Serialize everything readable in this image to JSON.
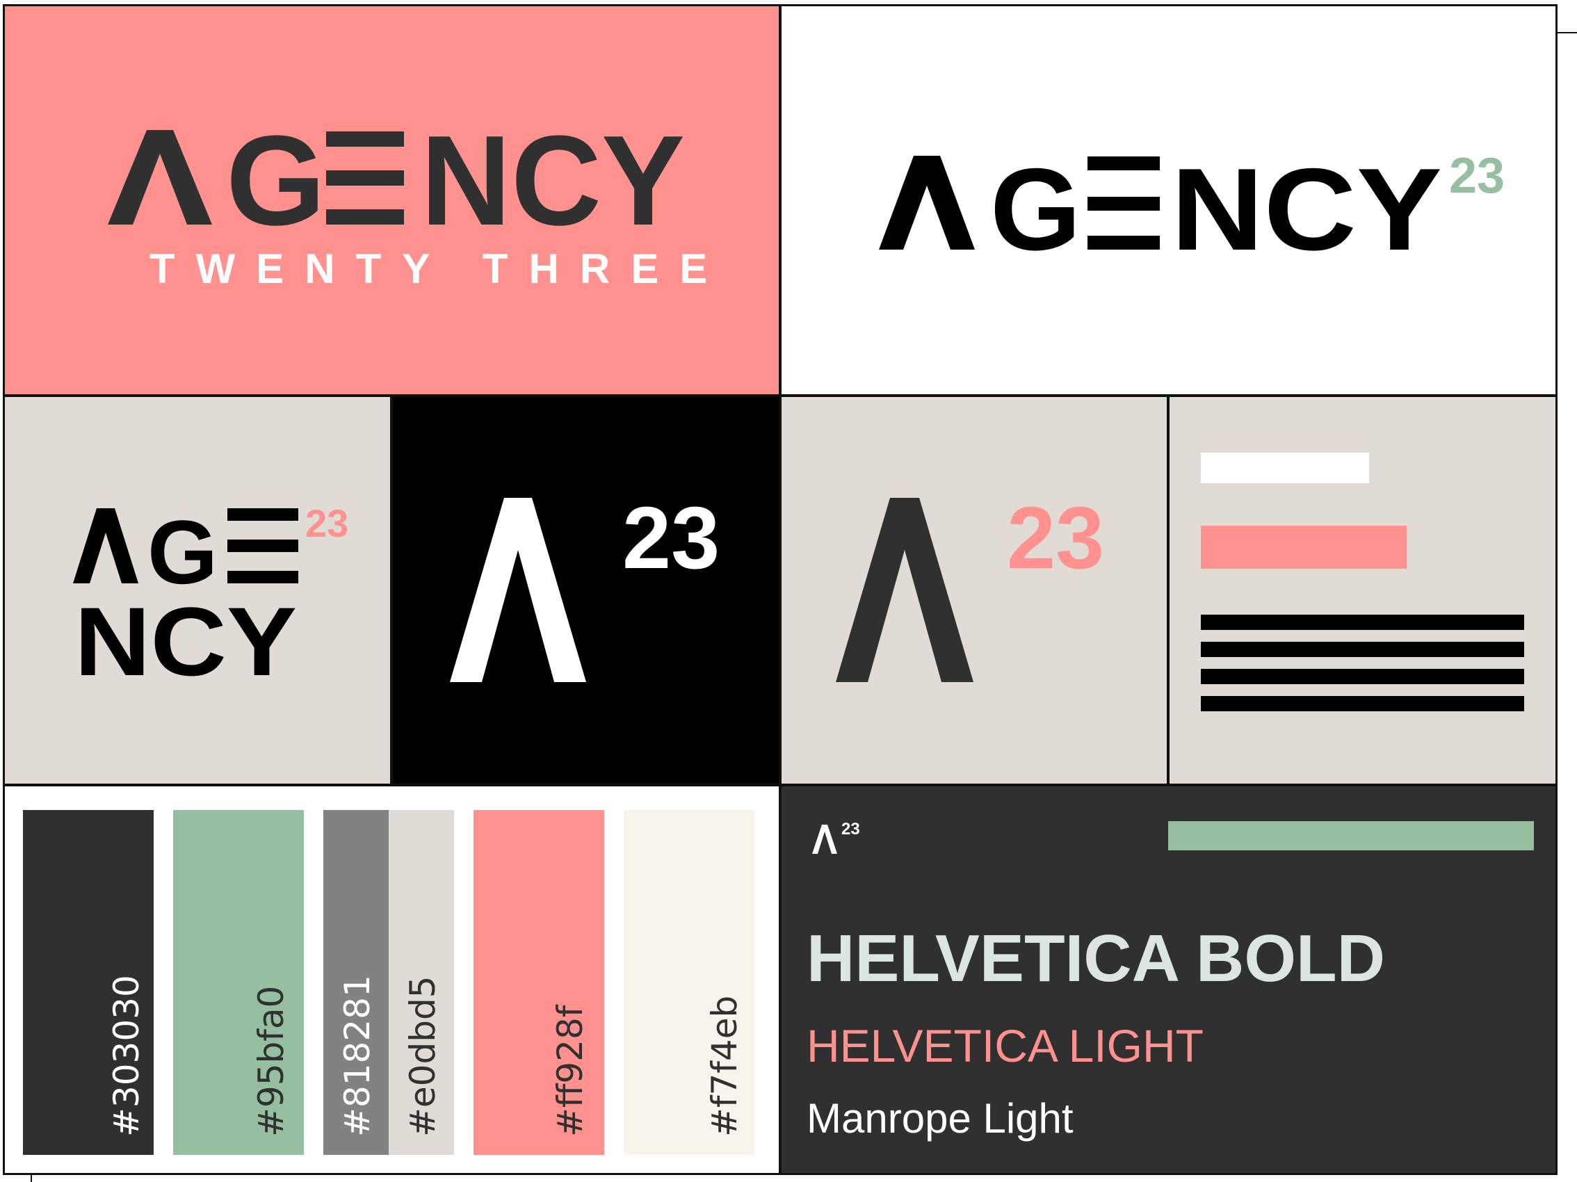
{
  "brand": {
    "wordmark": "AGENCY",
    "wordmark_top": "AGE",
    "wordmark_bottom": "NCY",
    "subtitle": "TWENTY THREE",
    "superscript": "23"
  },
  "palette": [
    {
      "hex": "#303030",
      "label": "#303030"
    },
    {
      "hex": "#95bfa0",
      "label": "#95bfa0"
    },
    {
      "hex": "#818281",
      "label": "#818281"
    },
    {
      "hex": "#e0dbd5",
      "label": "#e0dbd5"
    },
    {
      "hex": "#ff928f",
      "label": "#ff928f"
    },
    {
      "hex": "#f7f4eb",
      "label": "#f7f4eb"
    }
  ],
  "typography": {
    "heading": "HELVETICA BOLD",
    "subheading": "HELVETICA LIGHT",
    "body": "Manrope Light"
  },
  "colors": {
    "coral": "#ff928f",
    "dark": "#303030",
    "green": "#95bfa0",
    "beige": "#e0dbd5",
    "black": "#000000",
    "white": "#ffffff",
    "pale": "#dbe6e3"
  }
}
